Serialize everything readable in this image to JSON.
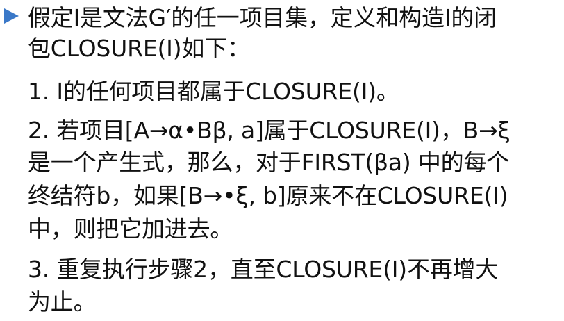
{
  "accent_color": "#3a78c8",
  "bullet_icon": "triangle-right-icon",
  "content": {
    "intro": [
      "假定I是文法G′的任一项目集，定义和构造I的闭",
      "包CLOSURE(I)如下："
    ],
    "step1": [
      "1. I的任何项目都属于CLOSURE(I)。"
    ],
    "step2": [
      "2. 若项目[A→α•Bβ, a]属于CLOSURE(I)，B→ξ",
      "是一个产生式，那么，对于FIRST(βa) 中的每个",
      "终结符b，如果[B→•ξ, b]原来不在CLOSURE(I)",
      "中，则把它加进去。"
    ],
    "step3": [
      "3. 重复执行步骤2，直至CLOSURE(I)不再增大",
      "为止。"
    ]
  }
}
